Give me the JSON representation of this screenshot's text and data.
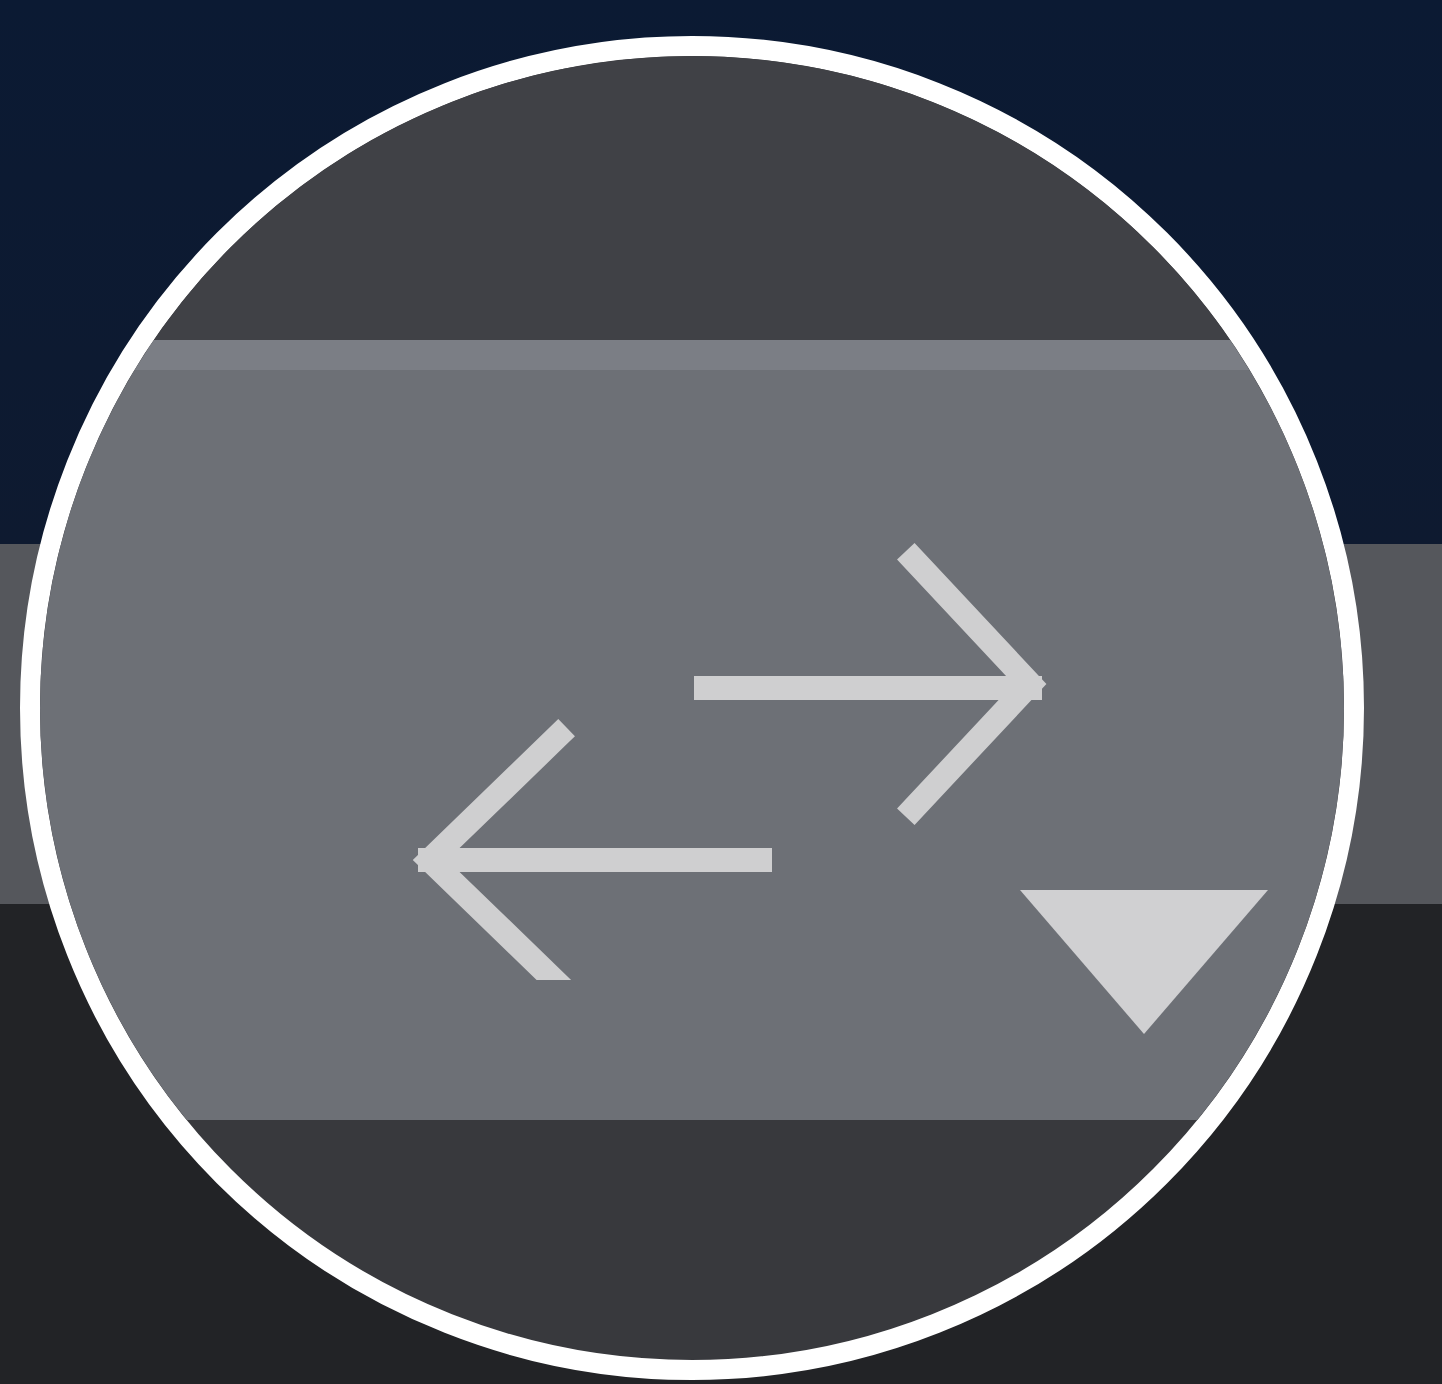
{
  "toolbar_button": {
    "dropdown": true
  }
}
